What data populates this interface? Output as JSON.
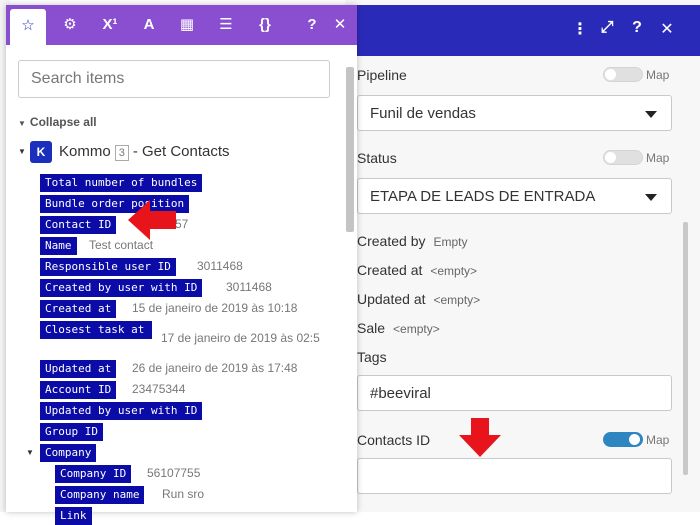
{
  "right_header": {
    "icons": [
      "more-icon",
      "expand-icon",
      "help-icon",
      "close-icon"
    ],
    "glyphs": [
      "⋮",
      "⤢",
      "?",
      "✕"
    ]
  },
  "fields": {
    "pipeline": {
      "label": "Pipeline",
      "value": "Funil de vendas",
      "map_label": "Map",
      "map_on": false
    },
    "status": {
      "label": "Status",
      "value": "ETAPA DE LEADS DE ENTRADA",
      "map_label": "Map",
      "map_on": false
    },
    "created_by": {
      "label": "Created by",
      "value": "Empty"
    },
    "created_at": {
      "label": "Created at",
      "value": "<empty>"
    },
    "updated_at": {
      "label": "Updated at",
      "value": "<empty>"
    },
    "sale": {
      "label": "Sale",
      "value": "<empty>"
    },
    "tags": {
      "label": "Tags",
      "value": "#beeviral"
    },
    "contacts_id": {
      "label": "Contacts ID",
      "value": "",
      "map_label": "Map",
      "map_on": true
    }
  },
  "popup": {
    "tabs": [
      {
        "name": "star",
        "glyph": "☆",
        "active": true
      },
      {
        "name": "gear",
        "glyph": "⚙",
        "active": false
      },
      {
        "name": "superscript",
        "glyph": "X¹",
        "active": false
      },
      {
        "name": "text",
        "glyph": "A",
        "active": false
      },
      {
        "name": "calendar",
        "glyph": "▦",
        "active": false
      },
      {
        "name": "table",
        "glyph": "☰",
        "active": false
      },
      {
        "name": "braces",
        "glyph": "{}",
        "active": false
      }
    ],
    "help_glyph": "?",
    "close_glyph": "✕",
    "search_placeholder": "Search items",
    "collapse_all": "Collapse all",
    "module": {
      "logo": "K",
      "name": "Kommo",
      "number": "3",
      "action": "- Get Contacts"
    },
    "items": [
      {
        "label": "Total number of bundles",
        "value": ""
      },
      {
        "label": "Bundle order position",
        "value": ""
      },
      {
        "label": "Contact ID",
        "value": "57"
      },
      {
        "label": "Name",
        "value": "Test contact"
      },
      {
        "label": "Responsible user ID",
        "value": "3011468"
      },
      {
        "label": "Created by user with ID",
        "value": "3011468"
      },
      {
        "label": "Created at",
        "value": "15 de janeiro de 2019 às 10:18"
      },
      {
        "label": "Closest task at",
        "value": "17 de janeiro de 2019 às 02:5"
      },
      {
        "label": "Updated at",
        "value": "26 de janeiro de 2019 às 17:48"
      },
      {
        "label": "Account ID",
        "value": "23475344"
      },
      {
        "label": "Updated by user with ID",
        "value": ""
      },
      {
        "label": "Group ID",
        "value": ""
      },
      {
        "label": "Company",
        "value": ""
      }
    ],
    "company_items": [
      {
        "label": "Company ID",
        "value": "56107755"
      },
      {
        "label": "Company name",
        "value": "Run sro"
      },
      {
        "label": "Link",
        "value": ""
      }
    ]
  },
  "colors": {
    "accent_purple": "#8a4fd0",
    "header_blue": "#2a2ab8",
    "chip_blue": "#0b0ba8",
    "arrow_red": "#e8141c"
  }
}
